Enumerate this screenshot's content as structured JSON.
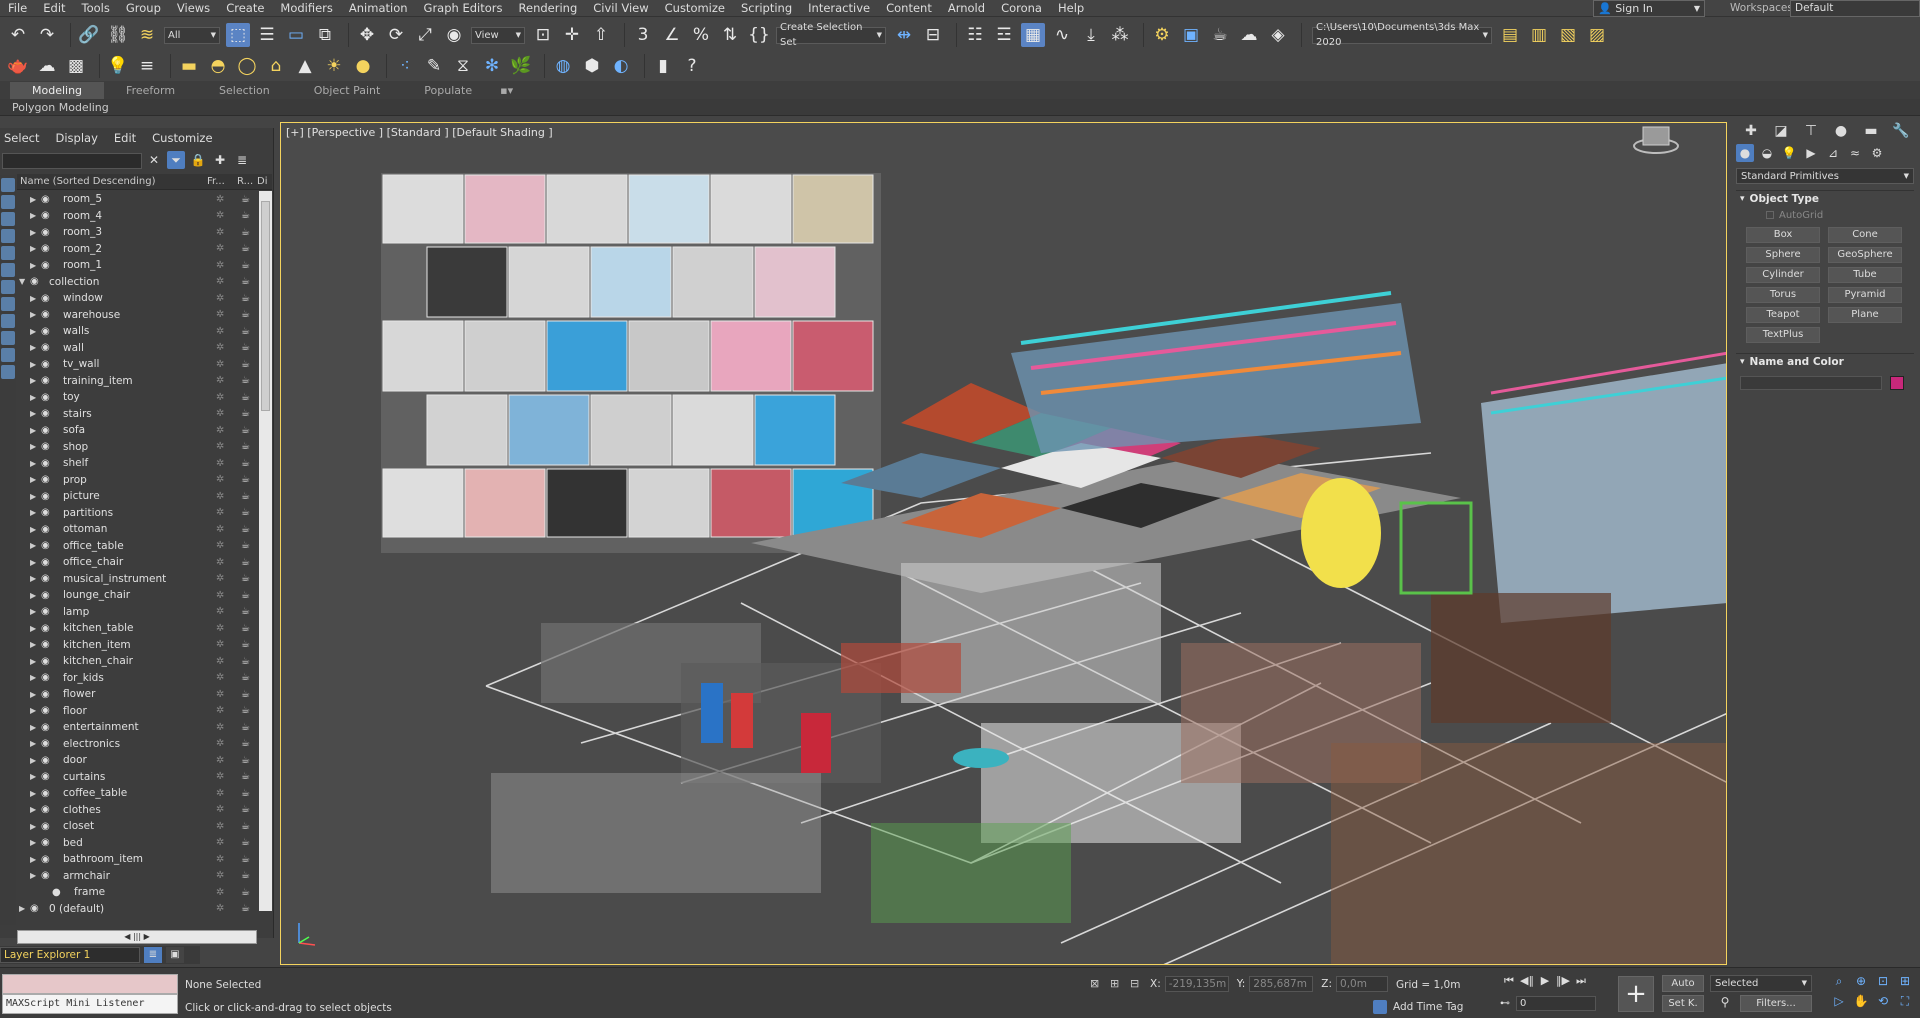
{
  "menubar": {
    "items": [
      "File",
      "Edit",
      "Tools",
      "Group",
      "Views",
      "Create",
      "Modifiers",
      "Animation",
      "Graph Editors",
      "Rendering",
      "Civil View",
      "Customize",
      "Scripting",
      "Interactive",
      "Content",
      "Arnold",
      "Corona",
      "Help"
    ],
    "signin": "Sign In",
    "workspaces_label": "Workspaces:",
    "workspaces_value": "Default"
  },
  "toolbar": {
    "selection_filter": "All",
    "reference_coord": "View",
    "named_selection": "Create Selection Set",
    "project_path": "C:\\Users\\10\\Documents\\3ds Max 2020"
  },
  "ribbon": {
    "tabs": [
      "Modeling",
      "Freeform",
      "Selection",
      "Object Paint",
      "Populate"
    ],
    "active_tab": "Modeling",
    "sub_label": "Polygon Modeling"
  },
  "explorer": {
    "menu": [
      "Select",
      "Display",
      "Edit",
      "Customize"
    ],
    "header_name": "Name (Sorted Descending)",
    "header_fr": "Fr...",
    "header_r": "R...",
    "header_di": "Di",
    "layers": [
      {
        "name": "room_5",
        "level": 1
      },
      {
        "name": "room_4",
        "level": 1
      },
      {
        "name": "room_3",
        "level": 1
      },
      {
        "name": "room_2",
        "level": 1
      },
      {
        "name": "room_1",
        "level": 1
      },
      {
        "name": "collection",
        "level": 0
      },
      {
        "name": "window",
        "level": 1
      },
      {
        "name": "warehouse",
        "level": 1
      },
      {
        "name": "walls",
        "level": 1
      },
      {
        "name": "wall",
        "level": 1
      },
      {
        "name": "tv_wall",
        "level": 1
      },
      {
        "name": "training_item",
        "level": 1
      },
      {
        "name": "toy",
        "level": 1
      },
      {
        "name": "stairs",
        "level": 1
      },
      {
        "name": "sofa",
        "level": 1
      },
      {
        "name": "shop",
        "level": 1
      },
      {
        "name": "shelf",
        "level": 1
      },
      {
        "name": "prop",
        "level": 1
      },
      {
        "name": "picture",
        "level": 1
      },
      {
        "name": "partitions",
        "level": 1
      },
      {
        "name": "ottoman",
        "level": 1
      },
      {
        "name": "office_table",
        "level": 1
      },
      {
        "name": "office_chair",
        "level": 1
      },
      {
        "name": "musical_instrument",
        "level": 1
      },
      {
        "name": "lounge_chair",
        "level": 1
      },
      {
        "name": "lamp",
        "level": 1
      },
      {
        "name": "kitchen_table",
        "level": 1
      },
      {
        "name": "kitchen_item",
        "level": 1
      },
      {
        "name": "kitchen_chair",
        "level": 1
      },
      {
        "name": "for_kids",
        "level": 1
      },
      {
        "name": "flower",
        "level": 1
      },
      {
        "name": "floor",
        "level": 1
      },
      {
        "name": "entertainment",
        "level": 1
      },
      {
        "name": "electronics",
        "level": 1
      },
      {
        "name": "door",
        "level": 1
      },
      {
        "name": "curtains",
        "level": 1
      },
      {
        "name": "coffee_table",
        "level": 1
      },
      {
        "name": "clothes",
        "level": 1
      },
      {
        "name": "closet",
        "level": 1
      },
      {
        "name": "bed",
        "level": 1
      },
      {
        "name": "bathroom_item",
        "level": 1
      },
      {
        "name": "armchair",
        "level": 1
      },
      {
        "name": "frame",
        "level": 2
      },
      {
        "name": "0 (default)",
        "level": 0
      }
    ],
    "layer_explorer": "Layer Explorer 1"
  },
  "viewport": {
    "label": "[+] [Perspective ] [Standard ] [Default Shading ]"
  },
  "command_panel": {
    "category": "Standard Primitives",
    "object_type_title": "Object Type",
    "autogrid": "AutoGrid",
    "buttons": [
      "Box",
      "Cone",
      "Sphere",
      "GeoSphere",
      "Cylinder",
      "Tube",
      "Torus",
      "Pyramid",
      "Teapot",
      "Plane",
      "TextPlus"
    ],
    "name_color_title": "Name and Color",
    "swatch_color": "#c8287a"
  },
  "status": {
    "maxscript_label": "MAXScript Mini Listener",
    "selected": "None Selected",
    "prompt": "Click or click-and-drag to select objects",
    "x_label": "X:",
    "x_value": "-219,135m",
    "y_label": "Y:",
    "y_value": "285,687m",
    "z_label": "Z:",
    "z_value": "0,0m",
    "grid": "Grid = 1,0m",
    "add_time_tag": "Add Time Tag",
    "frame": "0",
    "auto": "Auto",
    "setk": "Set K.",
    "selected_dropdown": "Selected",
    "filters": "Filters..."
  }
}
